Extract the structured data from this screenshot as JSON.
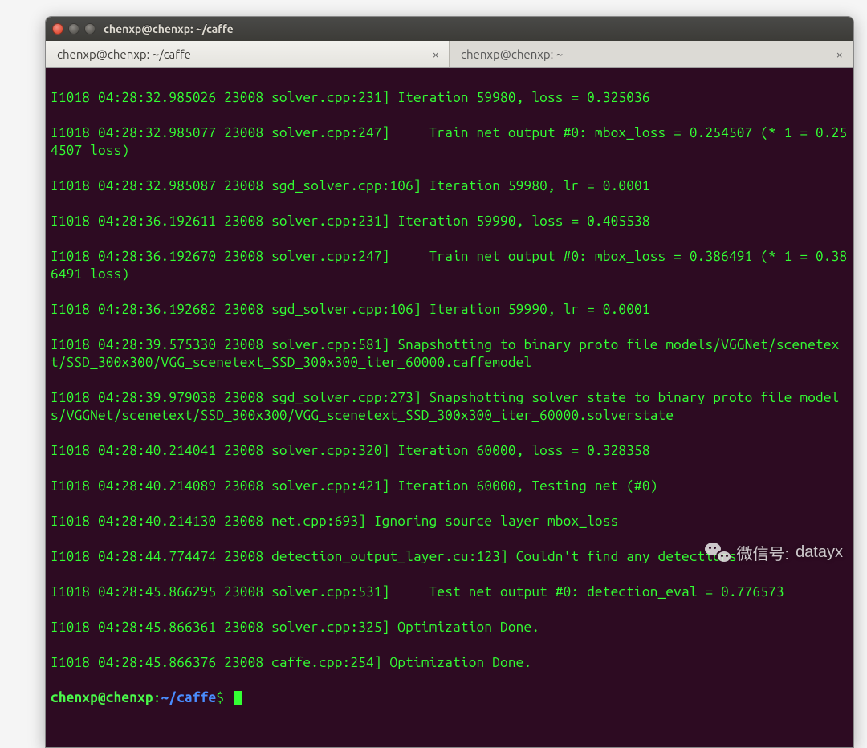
{
  "window": {
    "title": "chenxp@chenxp: ~/caffe"
  },
  "tabs": [
    {
      "label": "chenxp@chenxp: ~/caffe",
      "active": true
    },
    {
      "label": "chenxp@chenxp: ~",
      "active": false
    }
  ],
  "terminal": {
    "lines": [
      "I1018 04:28:32.985026 23008 solver.cpp:231] Iteration 59980, loss = 0.325036",
      "I1018 04:28:32.985077 23008 solver.cpp:247]     Train net output #0: mbox_loss = 0.254507 (* 1 = 0.254507 loss)",
      "I1018 04:28:32.985087 23008 sgd_solver.cpp:106] Iteration 59980, lr = 0.0001",
      "I1018 04:28:36.192611 23008 solver.cpp:231] Iteration 59990, loss = 0.405538",
      "I1018 04:28:36.192670 23008 solver.cpp:247]     Train net output #0: mbox_loss = 0.386491 (* 1 = 0.386491 loss)",
      "I1018 04:28:36.192682 23008 sgd_solver.cpp:106] Iteration 59990, lr = 0.0001",
      "I1018 04:28:39.575330 23008 solver.cpp:581] Snapshotting to binary proto file models/VGGNet/scenetext/SSD_300x300/VGG_scenetext_SSD_300x300_iter_60000.caffemodel",
      "I1018 04:28:39.979038 23008 sgd_solver.cpp:273] Snapshotting solver state to binary proto file models/VGGNet/scenetext/SSD_300x300/VGG_scenetext_SSD_300x300_iter_60000.solverstate",
      "I1018 04:28:40.214041 23008 solver.cpp:320] Iteration 60000, loss = 0.328358",
      "I1018 04:28:40.214089 23008 solver.cpp:421] Iteration 60000, Testing net (#0)",
      "I1018 04:28:40.214130 23008 net.cpp:693] Ignoring source layer mbox_loss",
      "I1018 04:28:44.774474 23008 detection_output_layer.cu:123] Couldn't find any detections",
      "I1018 04:28:45.866295 23008 solver.cpp:531]     Test net output #0: detection_eval = 0.776573",
      "I1018 04:28:45.866361 23008 solver.cpp:325] Optimization Done.",
      "I1018 04:28:45.866376 23008 caffe.cpp:254] Optimization Done."
    ],
    "prompt": {
      "user_host": "chenxp@chenxp",
      "separator": ":",
      "path": "~/caffe",
      "symbol": "$"
    }
  },
  "watermark": {
    "label_prefix": "微信号:",
    "account": "datayx"
  }
}
